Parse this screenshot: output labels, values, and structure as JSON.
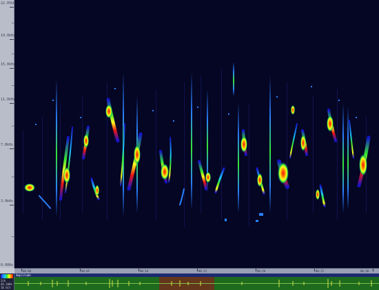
{
  "frequency_axis": {
    "labels": [
      "22.05kHz",
      "19.0kHz",
      "15.0kHz",
      "11.0kHz",
      "7.0kHz",
      "3.0kHz",
      "0.00Hz"
    ]
  },
  "time_ruler": {
    "labels": [
      "00:00",
      "00:05",
      "00:10",
      "00:15",
      "00:20",
      "00:25",
      "00:30"
    ]
  },
  "overview": {
    "title": "Amplitude",
    "side_lines": [
      "2ch",
      "44.1kHz",
      "16 bit"
    ]
  },
  "colors": {
    "spectrogram_background": "#050624",
    "low": "#1414c8",
    "mid": "#33e633",
    "high": "#ffff1e",
    "peak": "#e61414",
    "overview_background": "#1e6b1e",
    "overview_waveform": "#d6e84a",
    "overview_selection": "#8b1a1a"
  },
  "icons": {
    "color_scale": "spectrogram-color-scale-icon"
  }
}
